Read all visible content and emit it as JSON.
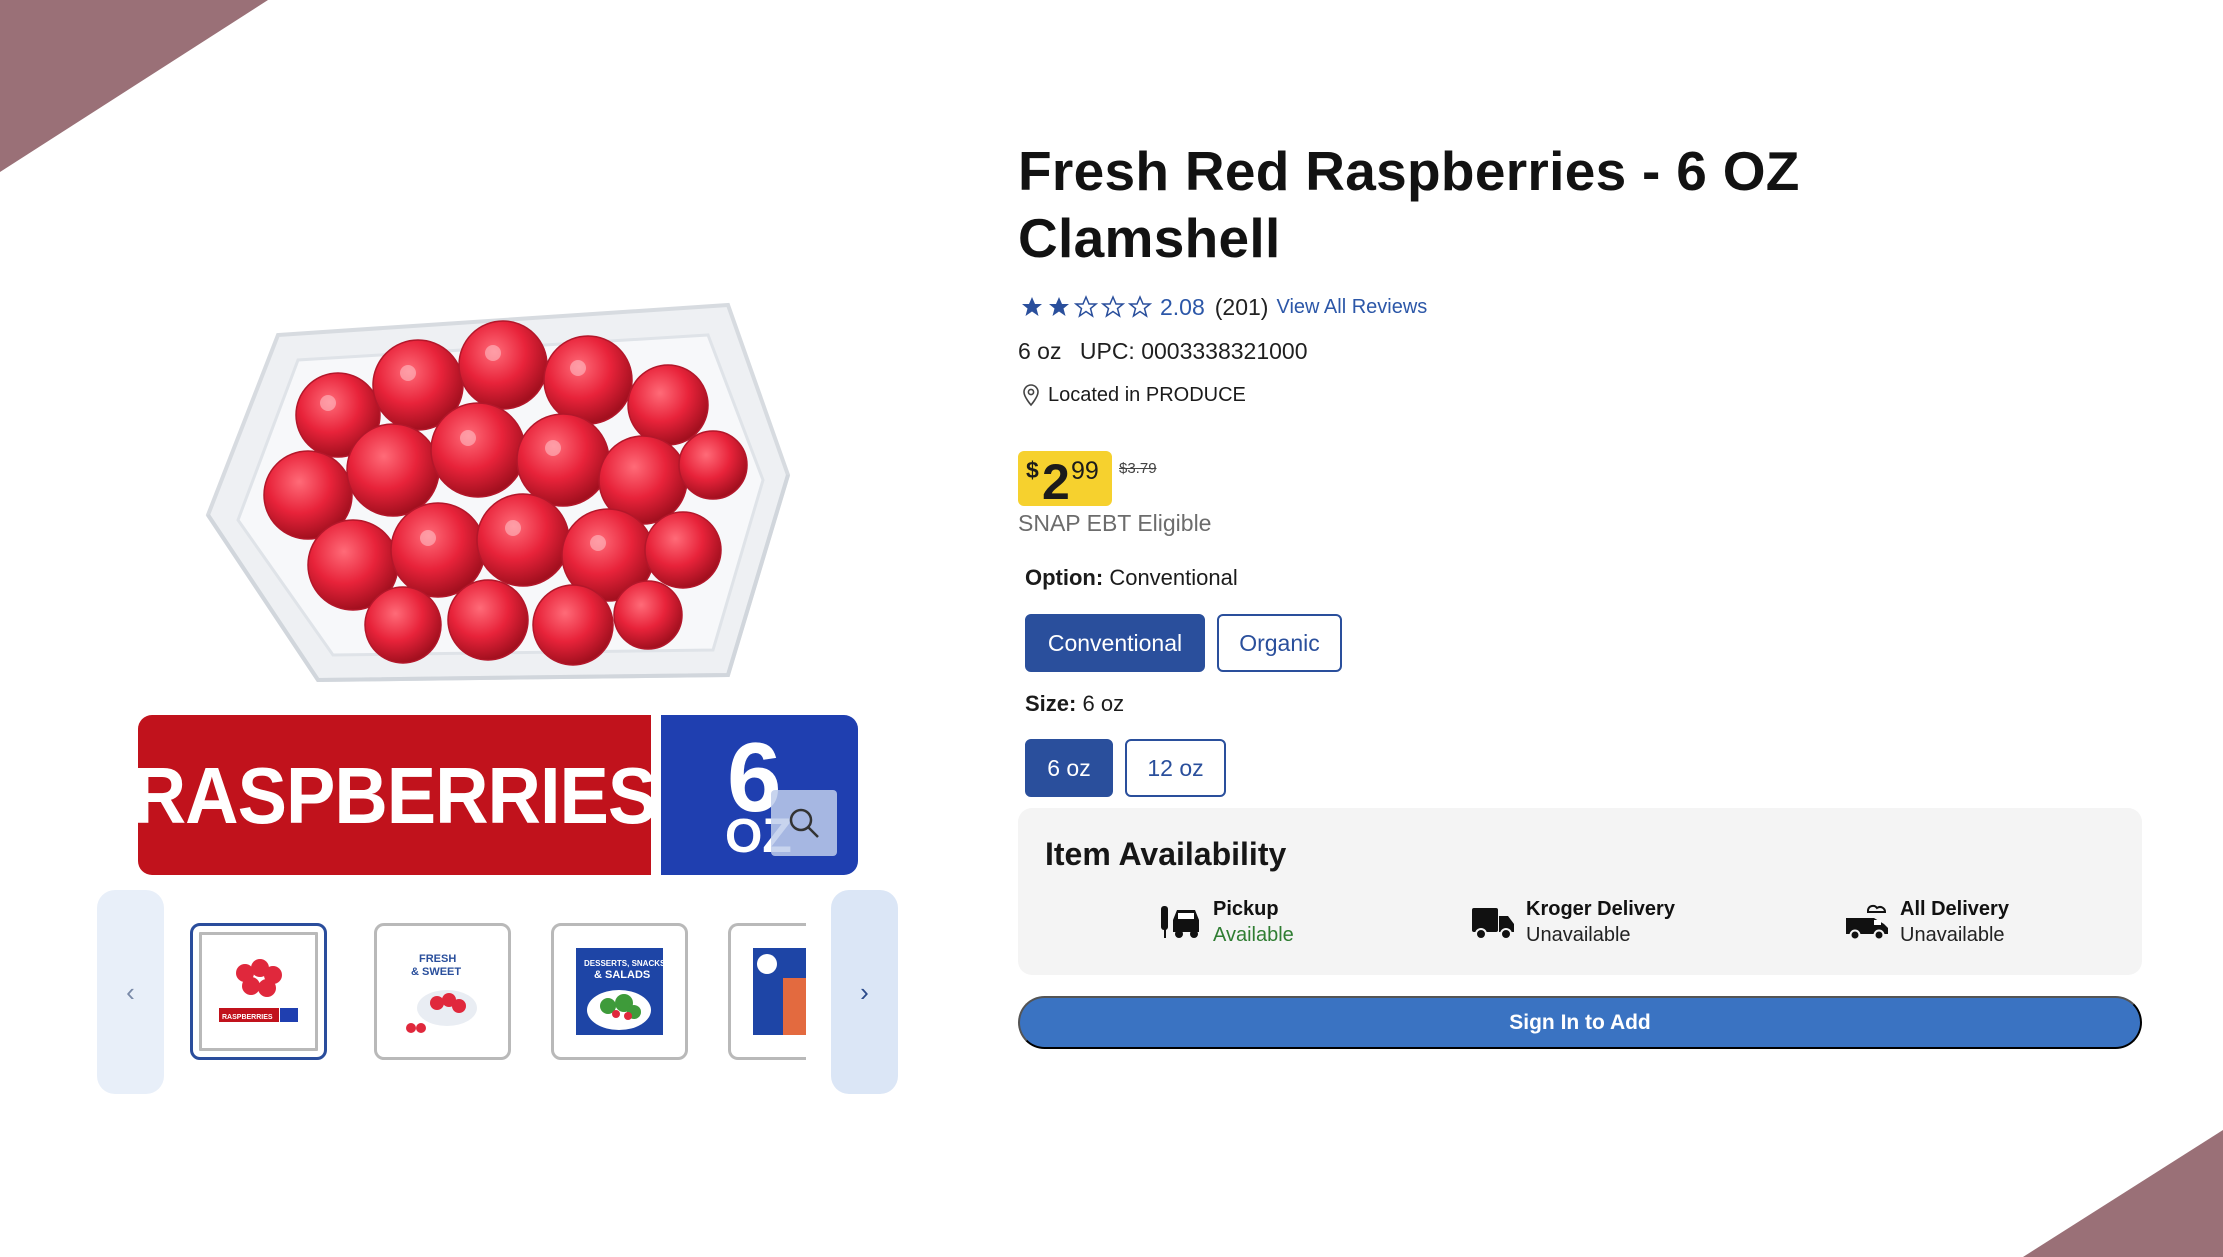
{
  "product": {
    "title": "Fresh Red Raspberries - 6 OZ Clamshell",
    "rating": {
      "stars": 2,
      "max_stars": 5,
      "value": "2.08",
      "count": "(201)",
      "reviews_link": "View All Reviews"
    },
    "size_text": "6 oz",
    "upc_text": "UPC: 0003338321000",
    "location": "Located in PRODUCE",
    "price": {
      "dollar_sign": "$",
      "whole": "2",
      "cents": "99",
      "original": "$3.79"
    },
    "snap": "SNAP EBT Eligible"
  },
  "image": {
    "banner_text": "RASPBERRIES",
    "banner_size_number": "6",
    "banner_size_unit": "OZ",
    "thumbnails": [
      {
        "name": "thumbnail-raspberries",
        "banner": "RASPBERRIES"
      },
      {
        "name": "thumbnail-fresh-sweet",
        "text": "FRESH & SWEET"
      },
      {
        "name": "thumbnail-salads",
        "text": "& SALADS"
      },
      {
        "name": "thumbnail-partial"
      }
    ]
  },
  "options": {
    "option_label": "Option:",
    "option_value": "Conventional",
    "option_choices": [
      "Conventional",
      "Organic"
    ],
    "size_label": "Size:",
    "size_value": "6 oz",
    "size_choices": [
      "6 oz",
      "12 oz"
    ]
  },
  "availability": {
    "title": "Item Availability",
    "items": [
      {
        "name": "Pickup",
        "status": "Available",
        "icon": "pickup-car-icon"
      },
      {
        "name": "Kroger Delivery",
        "status": "Unavailable",
        "icon": "delivery-truck-icon"
      },
      {
        "name": "All Delivery",
        "status": "Unavailable",
        "icon": "all-delivery-van-icon"
      }
    ]
  },
  "cta": {
    "sign_in_label": "Sign In to Add"
  },
  "colors": {
    "accent": "#2a4f9c",
    "price_tag": "#f6d12e",
    "cta": "#3a73c2",
    "available": "#2f7d32",
    "decor": "#9a7077"
  }
}
